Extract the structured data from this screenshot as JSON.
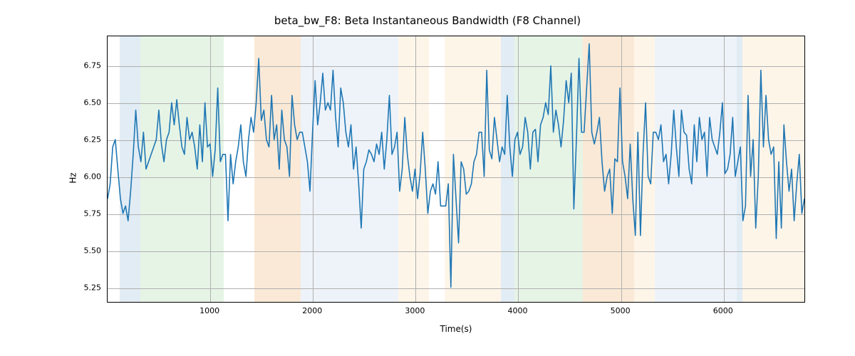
{
  "chart_data": {
    "type": "line",
    "title": "beta_bw_F8: Beta Instantaneous Bandwidth (F8 Channel)",
    "xlabel": "Time(s)",
    "ylabel": "Hz",
    "xlim": [
      0,
      6800
    ],
    "ylim": [
      5.15,
      6.95
    ],
    "xticks": [
      1000,
      2000,
      3000,
      4000,
      5000,
      6000
    ],
    "yticks": [
      5.25,
      5.5,
      5.75,
      6.0,
      6.25,
      6.5,
      6.75
    ],
    "ytick_labels": [
      "5.25",
      "5.50",
      "5.75",
      "6.00",
      "6.25",
      "6.50",
      "6.75"
    ],
    "bands": [
      {
        "x0": 120,
        "x1": 320,
        "color": "#a8c8e0"
      },
      {
        "x0": 320,
        "x1": 1130,
        "color": "#b8e0b8"
      },
      {
        "x0": 1430,
        "x1": 1880,
        "color": "#f2c08a"
      },
      {
        "x0": 1880,
        "x1": 2830,
        "color": "#cdddee"
      },
      {
        "x0": 2830,
        "x1": 3130,
        "color": "#fce1c0"
      },
      {
        "x0": 3280,
        "x1": 3830,
        "color": "#fce1c0"
      },
      {
        "x0": 3830,
        "x1": 3960,
        "color": "#a8c8e0"
      },
      {
        "x0": 3960,
        "x1": 4630,
        "color": "#b8e0b8"
      },
      {
        "x0": 4630,
        "x1": 5130,
        "color": "#f2c08a"
      },
      {
        "x0": 5130,
        "x1": 5330,
        "color": "#fce1c0"
      },
      {
        "x0": 5330,
        "x1": 6130,
        "color": "#cdddee"
      },
      {
        "x0": 6130,
        "x1": 6180,
        "color": "#a8c8e0"
      },
      {
        "x0": 6180,
        "x1": 6800,
        "color": "#fce1c0"
      }
    ],
    "x": [
      0,
      25,
      50,
      75,
      100,
      125,
      150,
      175,
      200,
      225,
      250,
      275,
      300,
      325,
      350,
      375,
      400,
      425,
      450,
      475,
      500,
      525,
      550,
      575,
      600,
      625,
      650,
      675,
      700,
      725,
      750,
      775,
      800,
      825,
      850,
      875,
      900,
      925,
      950,
      975,
      1000,
      1025,
      1050,
      1075,
      1100,
      1125,
      1150,
      1175,
      1200,
      1225,
      1250,
      1275,
      1300,
      1325,
      1350,
      1375,
      1400,
      1425,
      1450,
      1475,
      1500,
      1525,
      1550,
      1575,
      1600,
      1625,
      1650,
      1675,
      1700,
      1725,
      1750,
      1775,
      1800,
      1825,
      1850,
      1875,
      1900,
      1925,
      1950,
      1975,
      2000,
      2025,
      2050,
      2075,
      2100,
      2125,
      2150,
      2175,
      2200,
      2225,
      2250,
      2275,
      2300,
      2325,
      2350,
      2375,
      2400,
      2425,
      2450,
      2475,
      2500,
      2525,
      2550,
      2575,
      2600,
      2625,
      2650,
      2675,
      2700,
      2725,
      2750,
      2775,
      2800,
      2825,
      2850,
      2875,
      2900,
      2925,
      2950,
      2975,
      3000,
      3025,
      3050,
      3075,
      3100,
      3125,
      3150,
      3175,
      3200,
      3225,
      3250,
      3275,
      3300,
      3325,
      3350,
      3375,
      3400,
      3425,
      3450,
      3475,
      3500,
      3525,
      3550,
      3575,
      3600,
      3625,
      3650,
      3675,
      3700,
      3725,
      3750,
      3775,
      3800,
      3825,
      3850,
      3875,
      3900,
      3925,
      3950,
      3975,
      4000,
      4025,
      4050,
      4075,
      4100,
      4125,
      4150,
      4175,
      4200,
      4225,
      4250,
      4275,
      4300,
      4325,
      4350,
      4375,
      4400,
      4425,
      4450,
      4475,
      4500,
      4525,
      4550,
      4575,
      4600,
      4625,
      4650,
      4675,
      4700,
      4725,
      4750,
      4775,
      4800,
      4825,
      4850,
      4875,
      4900,
      4925,
      4950,
      4975,
      5000,
      5025,
      5050,
      5075,
      5100,
      5125,
      5150,
      5175,
      5200,
      5225,
      5250,
      5275,
      5300,
      5325,
      5350,
      5375,
      5400,
      5425,
      5450,
      5475,
      5500,
      5525,
      5550,
      5575,
      5600,
      5625,
      5650,
      5675,
      5700,
      5725,
      5750,
      5775,
      5800,
      5825,
      5850,
      5875,
      5900,
      5925,
      5950,
      5975,
      6000,
      6025,
      6050,
      6075,
      6100,
      6125,
      6150,
      6175,
      6200,
      6225,
      6250,
      6275,
      6300,
      6325,
      6350,
      6375,
      6400,
      6425,
      6450,
      6475,
      6500,
      6525,
      6550,
      6575,
      6600,
      6625,
      6650,
      6675,
      6700,
      6725,
      6750,
      6775,
      6800
    ],
    "values": [
      5.85,
      5.95,
      6.2,
      6.25,
      6.05,
      5.85,
      5.75,
      5.8,
      5.7,
      5.9,
      6.15,
      6.45,
      6.2,
      6.1,
      6.3,
      6.05,
      6.1,
      6.15,
      6.2,
      6.25,
      6.45,
      6.22,
      6.1,
      6.25,
      6.3,
      6.5,
      6.35,
      6.52,
      6.35,
      6.2,
      6.15,
      6.4,
      6.25,
      6.3,
      6.2,
      6.05,
      6.35,
      6.1,
      6.5,
      6.2,
      6.22,
      6.0,
      6.18,
      6.6,
      6.1,
      6.15,
      6.15,
      5.7,
      6.15,
      5.95,
      6.1,
      6.2,
      6.35,
      6.1,
      6.0,
      6.25,
      6.4,
      6.3,
      6.5,
      6.8,
      6.38,
      6.45,
      6.25,
      6.2,
      6.55,
      6.25,
      6.35,
      6.05,
      6.45,
      6.25,
      6.2,
      6.0,
      6.55,
      6.35,
      6.25,
      6.3,
      6.3,
      6.2,
      6.1,
      5.9,
      6.3,
      6.65,
      6.35,
      6.5,
      6.7,
      6.45,
      6.5,
      6.45,
      6.72,
      6.4,
      6.2,
      6.6,
      6.5,
      6.3,
      6.2,
      6.35,
      6.05,
      6.2,
      5.95,
      5.65,
      6.05,
      6.1,
      6.18,
      6.15,
      6.1,
      6.22,
      6.15,
      6.3,
      6.05,
      6.25,
      6.55,
      6.15,
      6.2,
      6.3,
      5.9,
      6.05,
      6.4,
      6.15,
      6.0,
      5.9,
      6.05,
      5.85,
      6.02,
      6.3,
      6.05,
      5.75,
      5.9,
      5.95,
      5.88,
      6.1,
      5.8,
      5.8,
      5.8,
      5.95,
      5.25,
      6.15,
      5.85,
      5.55,
      6.1,
      6.05,
      5.88,
      5.9,
      5.95,
      6.1,
      6.15,
      6.3,
      6.3,
      6.0,
      6.72,
      6.18,
      6.12,
      6.4,
      6.25,
      6.1,
      6.2,
      6.15,
      6.55,
      6.2,
      6.0,
      6.25,
      6.3,
      6.15,
      6.2,
      6.4,
      6.3,
      6.05,
      6.3,
      6.32,
      6.1,
      6.35,
      6.4,
      6.5,
      6.42,
      6.75,
      6.3,
      6.45,
      6.35,
      6.2,
      6.38,
      6.65,
      6.5,
      6.7,
      5.78,
      6.25,
      6.8,
      6.3,
      6.3,
      6.6,
      6.9,
      6.3,
      6.22,
      6.3,
      6.4,
      6.1,
      5.9,
      6.0,
      6.05,
      5.75,
      6.12,
      6.1,
      6.6,
      6.1,
      6.0,
      5.85,
      6.22,
      5.85,
      5.6,
      6.3,
      5.6,
      6.15,
      6.5,
      6.0,
      5.95,
      6.3,
      6.3,
      6.25,
      6.35,
      6.1,
      6.15,
      5.95,
      6.15,
      6.45,
      6.2,
      6.0,
      6.45,
      6.3,
      6.28,
      6.05,
      5.95,
      6.35,
      6.1,
      6.4,
      6.25,
      6.3,
      6.0,
      6.4,
      6.25,
      6.2,
      6.15,
      6.3,
      6.5,
      6.02,
      6.05,
      6.15,
      6.4,
      6.0,
      6.1,
      6.2,
      5.7,
      5.8,
      6.55,
      6.0,
      6.25,
      5.65,
      6.0,
      6.72,
      6.2,
      6.55,
      6.25,
      6.15,
      6.2,
      5.58,
      6.1,
      5.65,
      6.35,
      6.1,
      5.9,
      6.05,
      5.7,
      5.95,
      6.15,
      5.75,
      5.85
    ]
  }
}
